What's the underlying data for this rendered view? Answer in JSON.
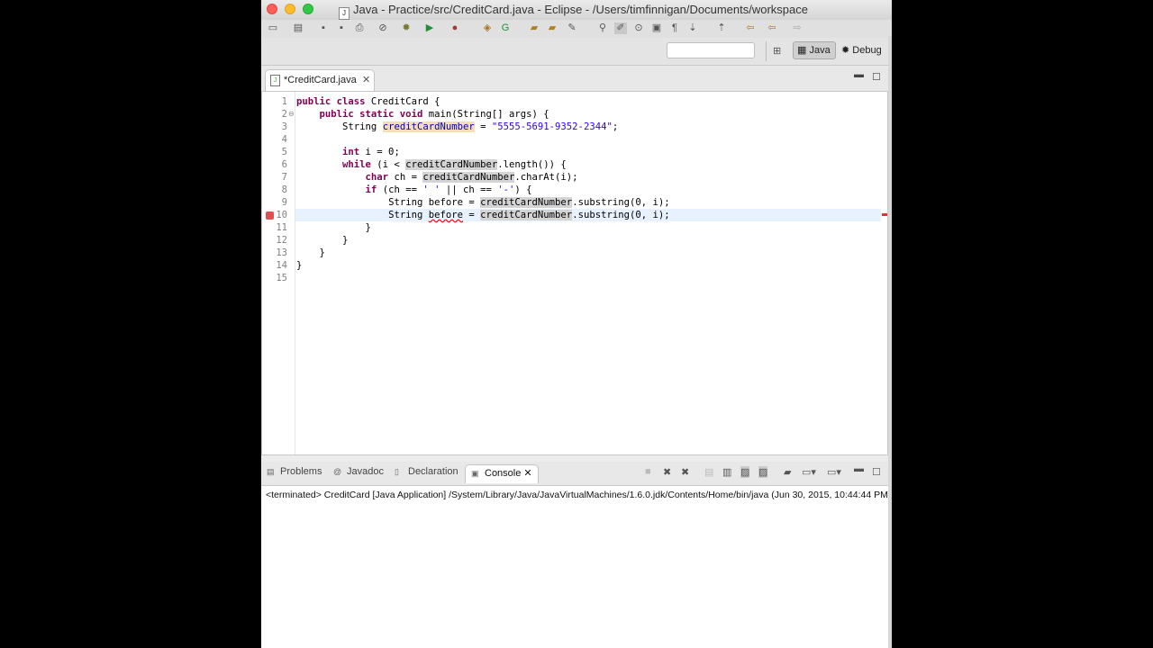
{
  "window": {
    "title": "Java - Practice/src/CreditCard.java - Eclipse - /Users/timfinnigan/Documents/workspace"
  },
  "toolbar": {
    "icons": [
      "new-icon",
      "save-icon",
      "save-all-icon",
      "print-icon",
      "skip-breakpoints-icon",
      "debug-icon",
      "run-icon",
      "external-tools-icon",
      "new-java-project-icon",
      "new-class-icon",
      "open-type-icon",
      "search-icon",
      "next-annotation-icon",
      "previous-annotation-icon",
      "back-icon",
      "forward-icon"
    ]
  },
  "perspectives": {
    "java_label": "Java",
    "debug_label": "Debug"
  },
  "editor": {
    "tab_label": "*CreditCard.java",
    "lines": [
      {
        "n": "1"
      },
      {
        "n": "2"
      },
      {
        "n": "3"
      },
      {
        "n": "4"
      },
      {
        "n": "5"
      },
      {
        "n": "6"
      },
      {
        "n": "7"
      },
      {
        "n": "8"
      },
      {
        "n": "9"
      },
      {
        "n": "10"
      },
      {
        "n": "11"
      },
      {
        "n": "12"
      },
      {
        "n": "13"
      },
      {
        "n": "14"
      },
      {
        "n": "15"
      }
    ],
    "code": {
      "l1_kw": "public class",
      "l1_rest": " CreditCard {",
      "l2_kw": "public static void",
      "l2_rest": " main(String[] args) {",
      "l3_type": "String ",
      "l3_var": "creditCardNumber",
      "l3_eq": " = ",
      "l3_str": "\"5555-5691-9352-2344\"",
      "l3_end": ";",
      "l5_kw": "int",
      "l5_rest": " i = 0;",
      "l6_kw": "while",
      "l6_a": " (i < ",
      "l6_var": "creditCardNumber",
      "l6_b": ".length()) {",
      "l7_kw": "char",
      "l7_a": " ch = ",
      "l7_var": "creditCardNumber",
      "l7_b": ".charAt(i);",
      "l8_kw": "if",
      "l8_a": " (ch == ",
      "l8_s1": "' '",
      "l8_b": " || ch == ",
      "l8_s2": "'-'",
      "l8_c": ") {",
      "l9_a": "String before = ",
      "l9_var": "creditCardNumber",
      "l9_b": ".substring(0, i);",
      "l10_a": "String ",
      "l10_err": "before",
      "l10_b": " = ",
      "l10_var": "creditCardNumber",
      "l10_c": ".substring(0, i);",
      "l11": "}",
      "l12": "}",
      "l13": "}",
      "l14": "}"
    }
  },
  "console": {
    "tabs": [
      "Problems",
      "Javadoc",
      "Declaration",
      "Console"
    ],
    "status": "<terminated> CreditCard [Java Application] /System/Library/Java/JavaVirtualMachines/1.6.0.jdk/Contents/Home/bin/java (Jun 30, 2015, 10:44:44 PM)"
  }
}
